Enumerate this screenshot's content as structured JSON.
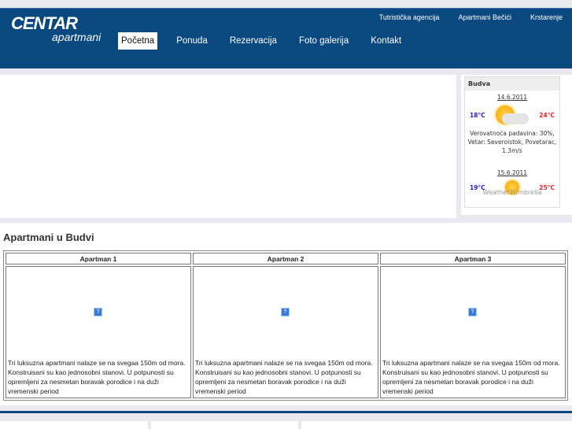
{
  "logo": {
    "line1": "CENTAR",
    "line2": "apartmani"
  },
  "top_links": [
    "Tutristička agencija",
    "Apartmani Bečići",
    "Krstarenje"
  ],
  "nav": [
    "Početna",
    "Ponuda",
    "Rezervacija",
    "Foto galerija",
    "Kontakt"
  ],
  "weather": {
    "city": "Budva",
    "days": [
      {
        "date": "14.6.2011",
        "low": "18°C",
        "high": "24°C",
        "icon": "sun-cloud-icon",
        "desc": "Verovatnoća padavina: 30%, Vetar: Severoistok, Povetarac, 1.3m/s"
      },
      {
        "date": "15.6.2011",
        "low": "19°C",
        "high": "25°C",
        "icon": "sun-icon"
      }
    ],
    "credit": "Weather2Umbrella"
  },
  "section_title": "Apartmani u Budvi",
  "apartments": [
    {
      "name": "Apartman 1",
      "desc": "Tri luksuzna apartmani nalaze se na svegaa 150m od mora. Konstruisani su kao jednosobni stanovi. U potpunosti su opremljeni za nesmetan boravak porodice i na duži vremenski period"
    },
    {
      "name": "Apartman 2",
      "desc": "Tri luksuzna apartmani nalaze se na svegaa 150m od mora. Konstruisani su kao jednosobni stanovi. U potpunosti su opremljeni za nesmetan boravak porodice i na duži vremenski period"
    },
    {
      "name": "Apartman 3",
      "desc": "Tri luksuzna apartmani nalaze se na svegaa 150m od mora. Konstruisani su kao jednosobni stanovi. U potpunosti su opremljeni za nesmetan boravak porodice i na duži vremenski period"
    }
  ]
}
